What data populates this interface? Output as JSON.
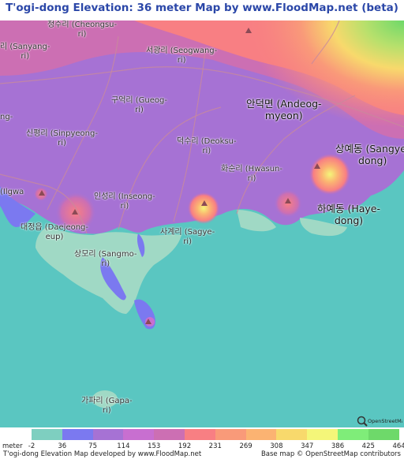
{
  "title": "T'ogi-dong Elevation: 36 meter Map by www.FloodMap.net (beta)",
  "places": {
    "cheongsu": "청수리 (Cheongsu-\nri)",
    "sanyang": "리 (Sanyang-\nri)",
    "seogwang": "서광리 (Seogwang-\nri)",
    "andeok": "안덕면 (Andeog-\nmyeon)",
    "gueok": "구억리 (Gueog-\nri)",
    "sinpyeong": "신평리 (Sinpyeong-\nri)",
    "deoksu": "덕수리 (Deoksu-\nri)",
    "sangye": "상예동 (Sangye-\ndong)",
    "hwasun": "화순리 (Hwasun-\nri)",
    "ilgwa": "(Ilgwa",
    "inseong": "인성리 (Inseong-\nri)",
    "haye": "하예동 (Haye-\ndong)",
    "daejeong": "대정읍 (Daejeong-\neup)",
    "sagye": "사계리 (Sagye-\nri)",
    "sangmo": "상모리 (Sangmo-\nri)",
    "gapa": "가파리 (Gapa-\nri)",
    "ng_left": "ng-"
  },
  "legend": {
    "meter_label": "meter",
    "ticks": [
      "-2",
      "36",
      "75",
      "114",
      "153",
      "192",
      "231",
      "269",
      "308",
      "347",
      "386",
      "425",
      "464"
    ],
    "colors": [
      "#7ecfc0",
      "#7b79f0",
      "#a672d4",
      "#c86fd0",
      "#cc6fb3",
      "#f87f83",
      "#f99a79",
      "#fbb372",
      "#f8d96c",
      "#f4f679",
      "#7fed79",
      "#6ed96a"
    ]
  },
  "footer": {
    "left": "T'ogi-dong Elevation Map developed by www.FloodMap.net",
    "right": "Base map © OpenStreetMap contributors"
  },
  "osm_badge": "OpenStreetMap",
  "colors": {
    "sea": "#5ac6c1",
    "land_low": "#a0d9c5"
  }
}
